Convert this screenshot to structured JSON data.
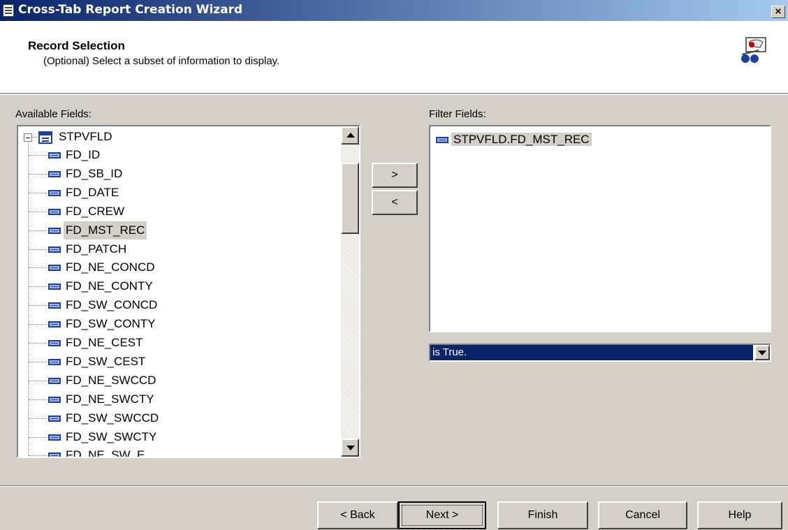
{
  "window": {
    "title": "Cross-Tab Report Creation Wizard",
    "close_label": "×"
  },
  "header": {
    "title": "Record Selection",
    "subtitle": "(Optional)  Select a subset of information to display."
  },
  "available": {
    "label": "Available Fields:",
    "table": "STPVFLD",
    "fields": [
      "FD_ID",
      "FD_SB_ID",
      "FD_DATE",
      "FD_CREW",
      "FD_MST_REC",
      "FD_PATCH",
      "FD_NE_CONCD",
      "FD_NE_CONTY",
      "FD_SW_CONCD",
      "FD_SW_CONTY",
      "FD_NE_CEST",
      "FD_SW_CEST",
      "FD_NE_SWCCD",
      "FD_NE_SWCTY",
      "FD_SW_SWCCD",
      "FD_SW_SWCTY",
      "FD_NE_SW_E"
    ],
    "selected": "FD_MST_REC"
  },
  "move": {
    "add": ">",
    "remove": "<"
  },
  "filter": {
    "label": "Filter Fields:",
    "items": [
      "STPVFLD.FD_MST_REC"
    ],
    "condition": "is True."
  },
  "footer": {
    "back": "< Back",
    "next": "Next >",
    "finish": "Finish",
    "cancel": "Cancel",
    "help": "Help"
  }
}
